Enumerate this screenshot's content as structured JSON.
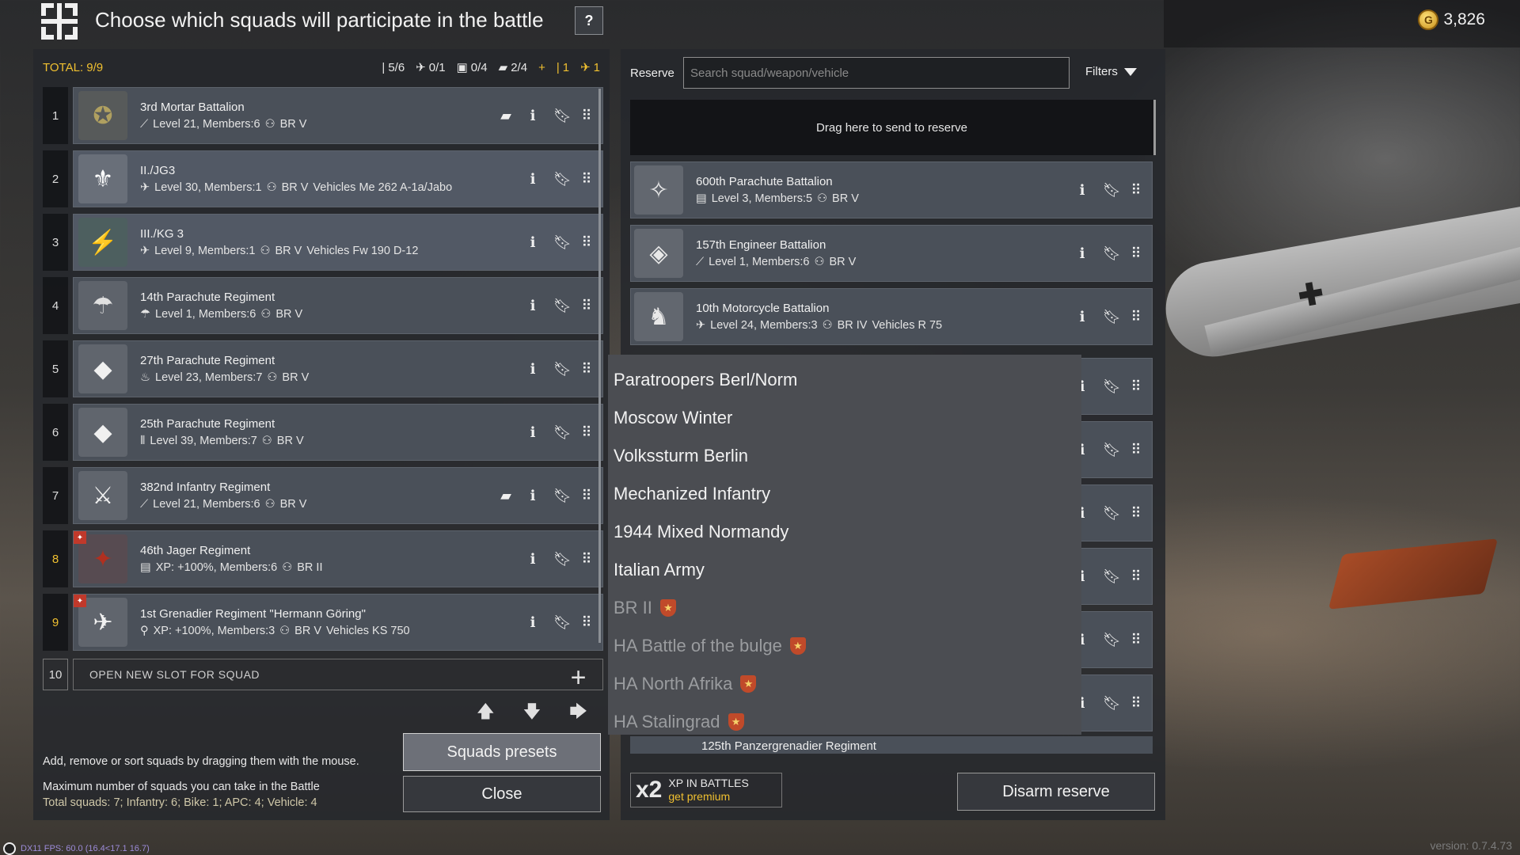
{
  "header": {
    "title": "Choose which squads will participate in the battle",
    "help_label": "?",
    "gold_amount": "3,826"
  },
  "totals": {
    "label": "TOTAL: 9/9",
    "infantry": "5/6",
    "aircraft": "0/1",
    "vehicle": "0/4",
    "apc": "2/4",
    "extra_inf": "1",
    "extra_air": "1"
  },
  "squads": [
    {
      "num": "1",
      "name": "3rd Mortar Battalion",
      "meta": "Level 21, Members:6",
      "br": "BR V",
      "vehicles": "",
      "icon": "mortar-icon",
      "glyph": "⟋",
      "book": true,
      "premium": false
    },
    {
      "num": "2",
      "name": "II./JG3",
      "meta": "Level 30, Members:1",
      "br": "BR V",
      "vehicles": "Vehicles Me 262 A-1a/Jabo",
      "icon": "plane-icon",
      "glyph": "✈",
      "book": false,
      "premium": false
    },
    {
      "num": "3",
      "name": "III./KG 3",
      "meta": "Level 9, Members:1",
      "br": "BR V",
      "vehicles": "Vehicles Fw 190 D-12",
      "icon": "plane-icon",
      "glyph": "✈",
      "book": false,
      "premium": false
    },
    {
      "num": "4",
      "name": "14th Parachute Regiment",
      "meta": "Level 1, Members:6",
      "br": "BR V",
      "vehicles": "",
      "icon": "parachute-icon",
      "glyph": "☂",
      "book": false,
      "premium": false
    },
    {
      "num": "5",
      "name": "27th Parachute Regiment",
      "meta": "Level 23, Members:7",
      "br": "BR V",
      "vehicles": "",
      "icon": "flame-icon",
      "glyph": "♨",
      "book": false,
      "premium": false
    },
    {
      "num": "6",
      "name": "25th Parachute Regiment",
      "meta": "Level 39, Members:7",
      "br": "BR V",
      "vehicles": "",
      "icon": "ammo-icon",
      "glyph": "⦀",
      "book": false,
      "premium": false
    },
    {
      "num": "7",
      "name": "382nd Infantry Regiment",
      "meta": "Level 21, Members:6",
      "br": "BR V",
      "vehicles": "",
      "icon": "mortar-icon",
      "glyph": "⟋",
      "book": true,
      "premium": false
    },
    {
      "num": "8",
      "name": "46th Jager Regiment",
      "meta": "XP: +100%, Members:6",
      "br": "BR II",
      "vehicles": "",
      "icon": "rifle-icon",
      "glyph": "▤",
      "book": false,
      "premium": true
    },
    {
      "num": "9",
      "name": "1st Grenadier Regiment \"Hermann Göring\"",
      "meta": "XP: +100%, Members:3",
      "br": "BR V",
      "vehicles": "Vehicles KS 750",
      "icon": "motorcycle-icon",
      "glyph": "⚲",
      "book": false,
      "premium": true
    }
  ],
  "open_slot": {
    "num": "10",
    "label": "OPEN NEW SLOT FOR SQUAD"
  },
  "hints": {
    "drag": "Add, remove or sort squads by dragging them with the mouse.",
    "max": "Maximum number of squads you can take in the Battle",
    "totals": "Total squads: 7; Infantry: 6; Bike: 1; APC: 4; Vehicle: 4"
  },
  "buttons": {
    "presets": "Squads presets",
    "close": "Close",
    "disarm": "Disarm reserve"
  },
  "reserve": {
    "label": "Reserve",
    "search_placeholder": "Search squad/weapon/vehicle",
    "filters_label": "Filters",
    "drop_text": "Drag here to send to reserve",
    "items": [
      {
        "name": "600th Parachute Battalion",
        "meta": "Level 3, Members:5",
        "br": "BR V",
        "vehicles": ""
      },
      {
        "name": "157th Engineer Battalion",
        "meta": "Level 1, Members:6",
        "br": "BR V",
        "vehicles": ""
      },
      {
        "name": "10th Motorcycle Battalion",
        "meta": "Level 24, Members:3",
        "br": "BR IV",
        "vehicles": "Vehicles R 75"
      }
    ],
    "partial_item": "125th Panzergrenadier Regiment"
  },
  "xp": {
    "multiplier": "x2",
    "title": "XP IN BATTLES",
    "premium": "get premium"
  },
  "presets_menu": [
    {
      "label": "Paratroopers Berl/Norm",
      "locked": false
    },
    {
      "label": "Moscow Winter",
      "locked": false
    },
    {
      "label": "Volkssturm Berlin",
      "locked": false
    },
    {
      "label": "Mechanized Infantry",
      "locked": false
    },
    {
      "label": "1944 Mixed Normandy",
      "locked": false
    },
    {
      "label": "Italian Army",
      "locked": false
    },
    {
      "label": "BR II",
      "locked": true
    },
    {
      "label": "HA Battle of the bulge",
      "locked": true
    },
    {
      "label": "HA North Afrika",
      "locked": true
    },
    {
      "label": "HA Stalingrad",
      "locked": true
    }
  ],
  "footer": {
    "version": "version: 0.7.4.73",
    "fps": "DX11 FPS: 60.0 (16.4<17.1 16.7)"
  },
  "colors": {
    "accent_gold": "#f0c030",
    "card": "#4a5059",
    "panel": "#26282c",
    "premium_red": "#c0392b"
  }
}
